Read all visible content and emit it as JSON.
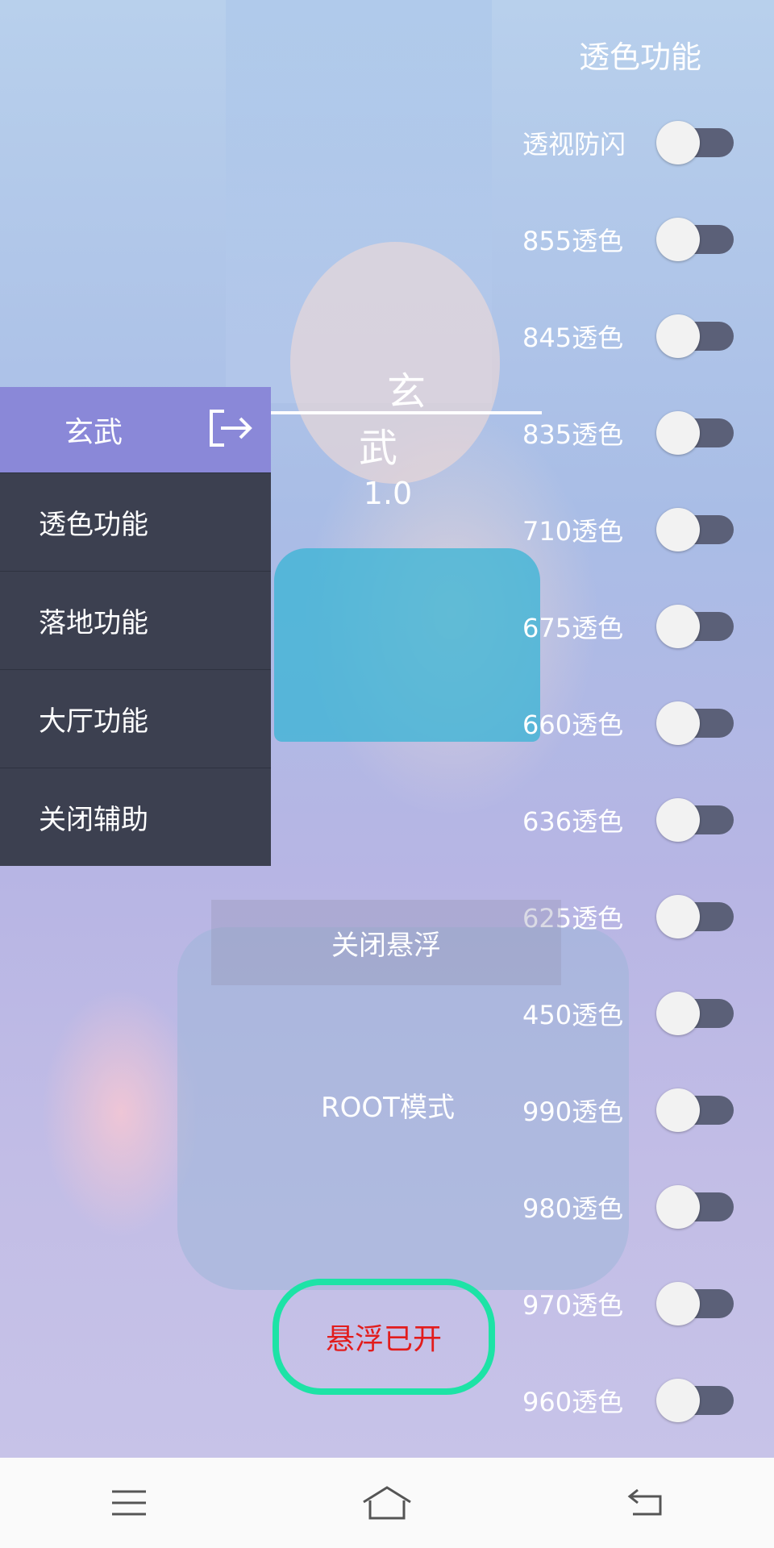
{
  "app": {
    "name": "玄武",
    "title": "玄　　武",
    "version": "1.0"
  },
  "side_menu": {
    "items": [
      {
        "label": "透色功能"
      },
      {
        "label": "落地功能"
      },
      {
        "label": "大厅功能"
      },
      {
        "label": "关闭辅助"
      }
    ]
  },
  "panel": {
    "title": "透色功能",
    "toggles": [
      {
        "label": "透视防闪",
        "on": false
      },
      {
        "label": "855透色",
        "on": false
      },
      {
        "label": "845透色",
        "on": false
      },
      {
        "label": "835透色",
        "on": false
      },
      {
        "label": "710透色",
        "on": false
      },
      {
        "label": "675透色",
        "on": false
      },
      {
        "label": "660透色",
        "on": false
      },
      {
        "label": "636透色",
        "on": false
      },
      {
        "label": "625透色",
        "on": false
      },
      {
        "label": "450透色",
        "on": false
      },
      {
        "label": "990透色",
        "on": false
      },
      {
        "label": "980透色",
        "on": false
      },
      {
        "label": "970透色",
        "on": false
      },
      {
        "label": "960透色",
        "on": false
      }
    ]
  },
  "buttons": {
    "close_float": "关闭悬浮",
    "root_mode": "ROOT模式",
    "float_status": "悬浮已开"
  },
  "colors": {
    "menu_header": "#8a88d8",
    "menu_bg": "#3c4050",
    "float_border": "#1de3a6",
    "float_text": "#e21c1c"
  },
  "nav": {
    "icons": [
      "menu-icon",
      "home-icon",
      "back-icon"
    ]
  }
}
